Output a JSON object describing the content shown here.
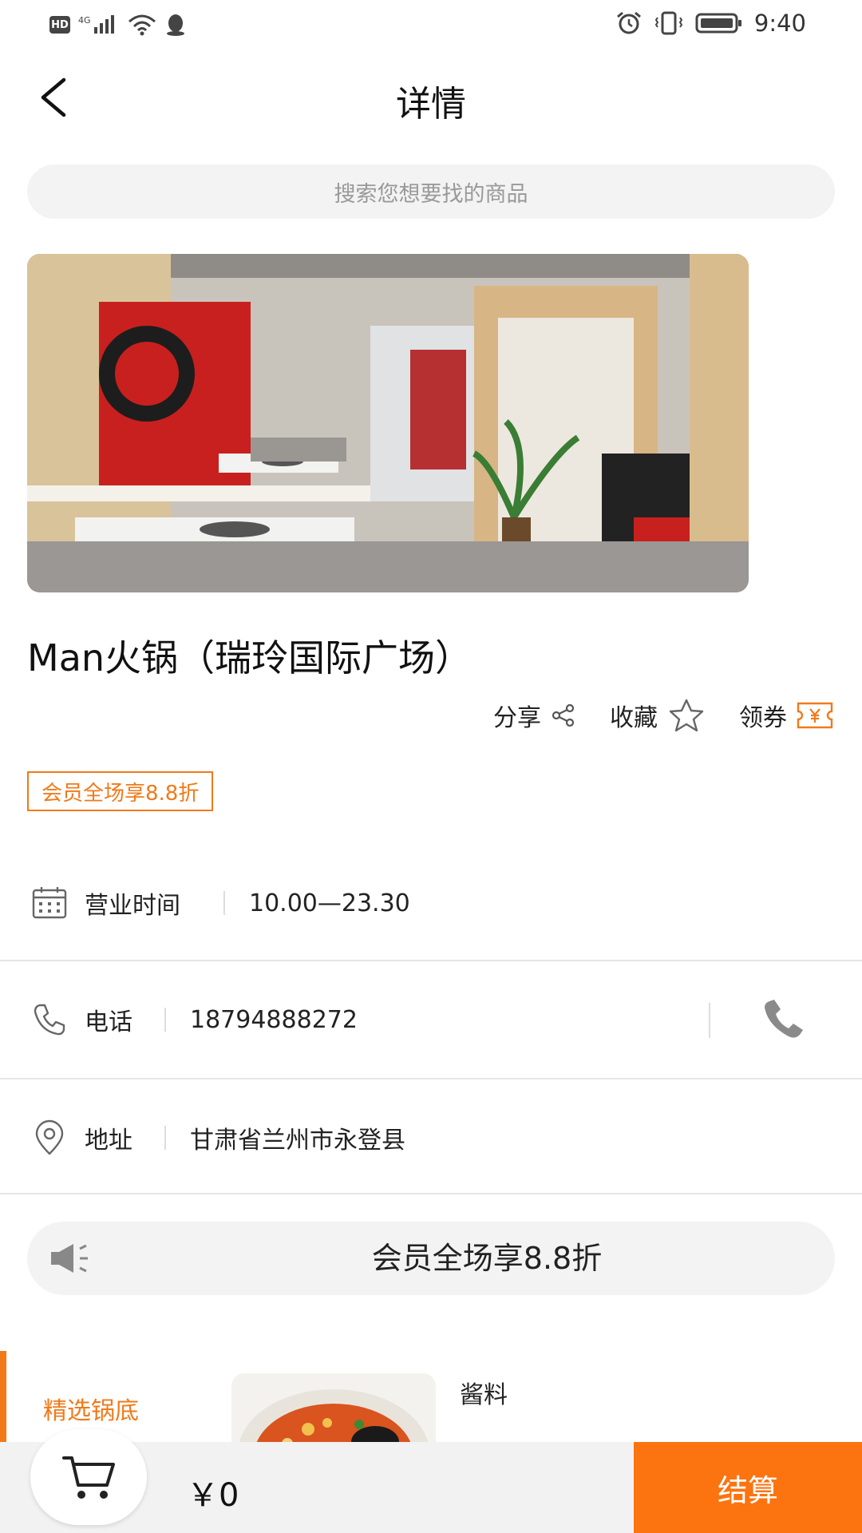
{
  "status_bar": {
    "hd": "HD",
    "network": "4G",
    "time": "9:40"
  },
  "header": {
    "title": "详情"
  },
  "search": {
    "placeholder": "搜索您想要找的商品"
  },
  "shop": {
    "name": "Man火锅（瑞玲国际广场）",
    "promo_tag": "会员全场享8.8折"
  },
  "actions": {
    "share": "分享",
    "favorite": "收藏",
    "coupon": "领券"
  },
  "info": {
    "hours_label": "营业时间",
    "hours_value": "10.00—23.30",
    "phone_label": "电话",
    "phone_value": "18794888272",
    "address_label": "地址",
    "address_value": "甘肃省兰州市永登县"
  },
  "notice": {
    "text": "会员全场享8.8折"
  },
  "menu": {
    "category": "精选锅底",
    "dish_name": "酱料"
  },
  "cart": {
    "total": "￥0",
    "checkout_label": "结算"
  },
  "colors": {
    "accent": "#f07a1a",
    "checkout_bg": "#fb7410",
    "search_bg": "#f3f3f3"
  }
}
